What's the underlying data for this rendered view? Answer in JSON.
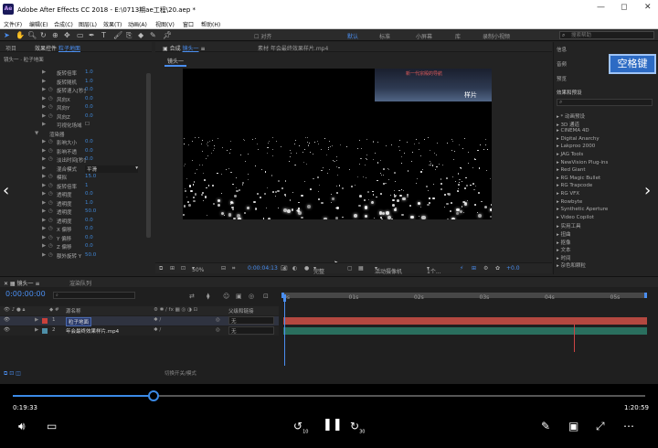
{
  "window": {
    "title": "Adobe After Effects CC 2018 - E:\\0713期ae工程\\20.aep *",
    "logo": "Ae",
    "min": "—",
    "max": "◻",
    "close": "✕"
  },
  "menu": [
    "文件(F)",
    "编辑(E)",
    "合成(C)",
    "图层(L)",
    "效果(T)",
    "动画(A)",
    "视图(V)",
    "窗口",
    "帮助(H)"
  ],
  "toolbar": {
    "align_label": "对齐",
    "workspaces": [
      "默认",
      "标准",
      "小屏幕",
      "库",
      "录制小视频"
    ],
    "active_workspace": "默认",
    "search_placeholder": "搜索帮助"
  },
  "left_panel": {
    "tab_project": "项目",
    "tab_effects": "效果控件",
    "tab_target": "粒子地面",
    "breadcrumb": "镜头一 · 粒子地面",
    "properties": [
      {
        "name": "旋转倍率",
        "value": "1.0",
        "indent": 1,
        "stopwatch": false
      },
      {
        "name": "旋转随机",
        "value": "1.0",
        "indent": 1,
        "stopwatch": false
      },
      {
        "name": "旋转速入[秒]",
        "value": "0.0",
        "indent": 1,
        "stopwatch": true
      },
      {
        "name": "风向X",
        "value": "0.0",
        "indent": 1,
        "stopwatch": true
      },
      {
        "name": "风向Y",
        "value": "0.0",
        "indent": 1,
        "stopwatch": true
      },
      {
        "name": "风向Z",
        "value": "0.0",
        "indent": 1,
        "stopwatch": true
      },
      {
        "name": "可视化场域",
        "value": "",
        "indent": 1,
        "stopwatch": false,
        "checkbox": true
      },
      {
        "name": "渲染器",
        "value": "",
        "indent": 0,
        "stopwatch": false,
        "group": true
      },
      {
        "name": "影响大小",
        "value": "0.0",
        "indent": 1,
        "stopwatch": true
      },
      {
        "name": "影响不透",
        "value": "0.0",
        "indent": 1,
        "stopwatch": true
      },
      {
        "name": "淡出时间[秒]",
        "value": "0.0",
        "indent": 1,
        "stopwatch": true
      },
      {
        "name": "混合模式",
        "value": "平滑",
        "indent": 1,
        "stopwatch": false,
        "select": true
      },
      {
        "name": "模拟",
        "value": "15.0",
        "indent": 1,
        "stopwatch": true
      },
      {
        "name": "旋转倍率",
        "value": "1",
        "indent": 1,
        "stopwatch": true
      },
      {
        "name": "透明度",
        "value": "0.0",
        "indent": 1,
        "stopwatch": true
      },
      {
        "name": "透明度",
        "value": "1.0",
        "indent": 1,
        "stopwatch": true
      },
      {
        "name": "透明度",
        "value": "50.0",
        "indent": 1,
        "stopwatch": true
      },
      {
        "name": "透明度",
        "value": "0.0",
        "indent": 1,
        "stopwatch": true
      },
      {
        "name": "X 偏移",
        "value": "0.0",
        "indent": 1,
        "stopwatch": true
      },
      {
        "name": "Y 偏移",
        "value": "0.0",
        "indent": 1,
        "stopwatch": true
      },
      {
        "name": "Z 偏移",
        "value": "0.0",
        "indent": 1,
        "stopwatch": true
      },
      {
        "name": "额外旋转 Y",
        "value": "50.0",
        "indent": 1,
        "stopwatch": true
      }
    ]
  },
  "comp_panel": {
    "tab_label": "合成",
    "comp_name": "镜头一",
    "footage_label": "素材 年会最终效果样片.mp4",
    "subtab": "镜头一",
    "overlay_text": "新一代宗殿的导航",
    "overlay_badge": "样片"
  },
  "viewer_controls": {
    "zoom": "50%",
    "timecode": "0:00:04:13",
    "quality": "完整",
    "camera": "活动摄像机",
    "views": "1个...",
    "exposure": "+0.0"
  },
  "right_panel": {
    "info": "信息",
    "audio": "音频",
    "preview": "预览",
    "overlay_key": "空格键",
    "effects_title": "效果和预设",
    "search_placeholder": "",
    "items": [
      "* 动画预设",
      "3D 通道",
      "CINEMA 4D",
      "Digital Anarchy",
      "Lakproo 2000",
      "JAG Tools",
      "NewVision Plug-ins",
      "Red Giant",
      "RG Magic Bullet",
      "RG Trapcode",
      "RG VFX",
      "Rowbyte",
      "Synthetic Aperture",
      "Video Copilot",
      "实用工具",
      "扭曲",
      "抠像",
      "文本",
      "时间",
      "杂色和颗粒"
    ]
  },
  "timeline": {
    "tab_label": "镜头一",
    "queue_label": "渲染队列",
    "timecode": "0:00:00:00",
    "col_name": "源名称",
    "col_parent": "父级和链接",
    "toggle_label": "切换开关/模式",
    "layers": [
      {
        "num": "1",
        "name": "粒子地面",
        "parent": "无",
        "color": "#c9413b"
      },
      {
        "num": "2",
        "name": "年会最终效果样片.mp4",
        "parent": "无",
        "color": "#4e8fa8"
      }
    ],
    "ruler": [
      "0s",
      "01s",
      "02s",
      "03s",
      "04s",
      "05s"
    ]
  },
  "player": {
    "current": "0:19:33",
    "total": "1:20:59",
    "progress": 0.222,
    "skip_back": "10",
    "skip_fwd": "30"
  },
  "colors": {
    "accent": "#4a8ef0",
    "player_bar": "#3b8ae6",
    "layer1": "#b44840",
    "layer2": "#2a6f5e"
  }
}
